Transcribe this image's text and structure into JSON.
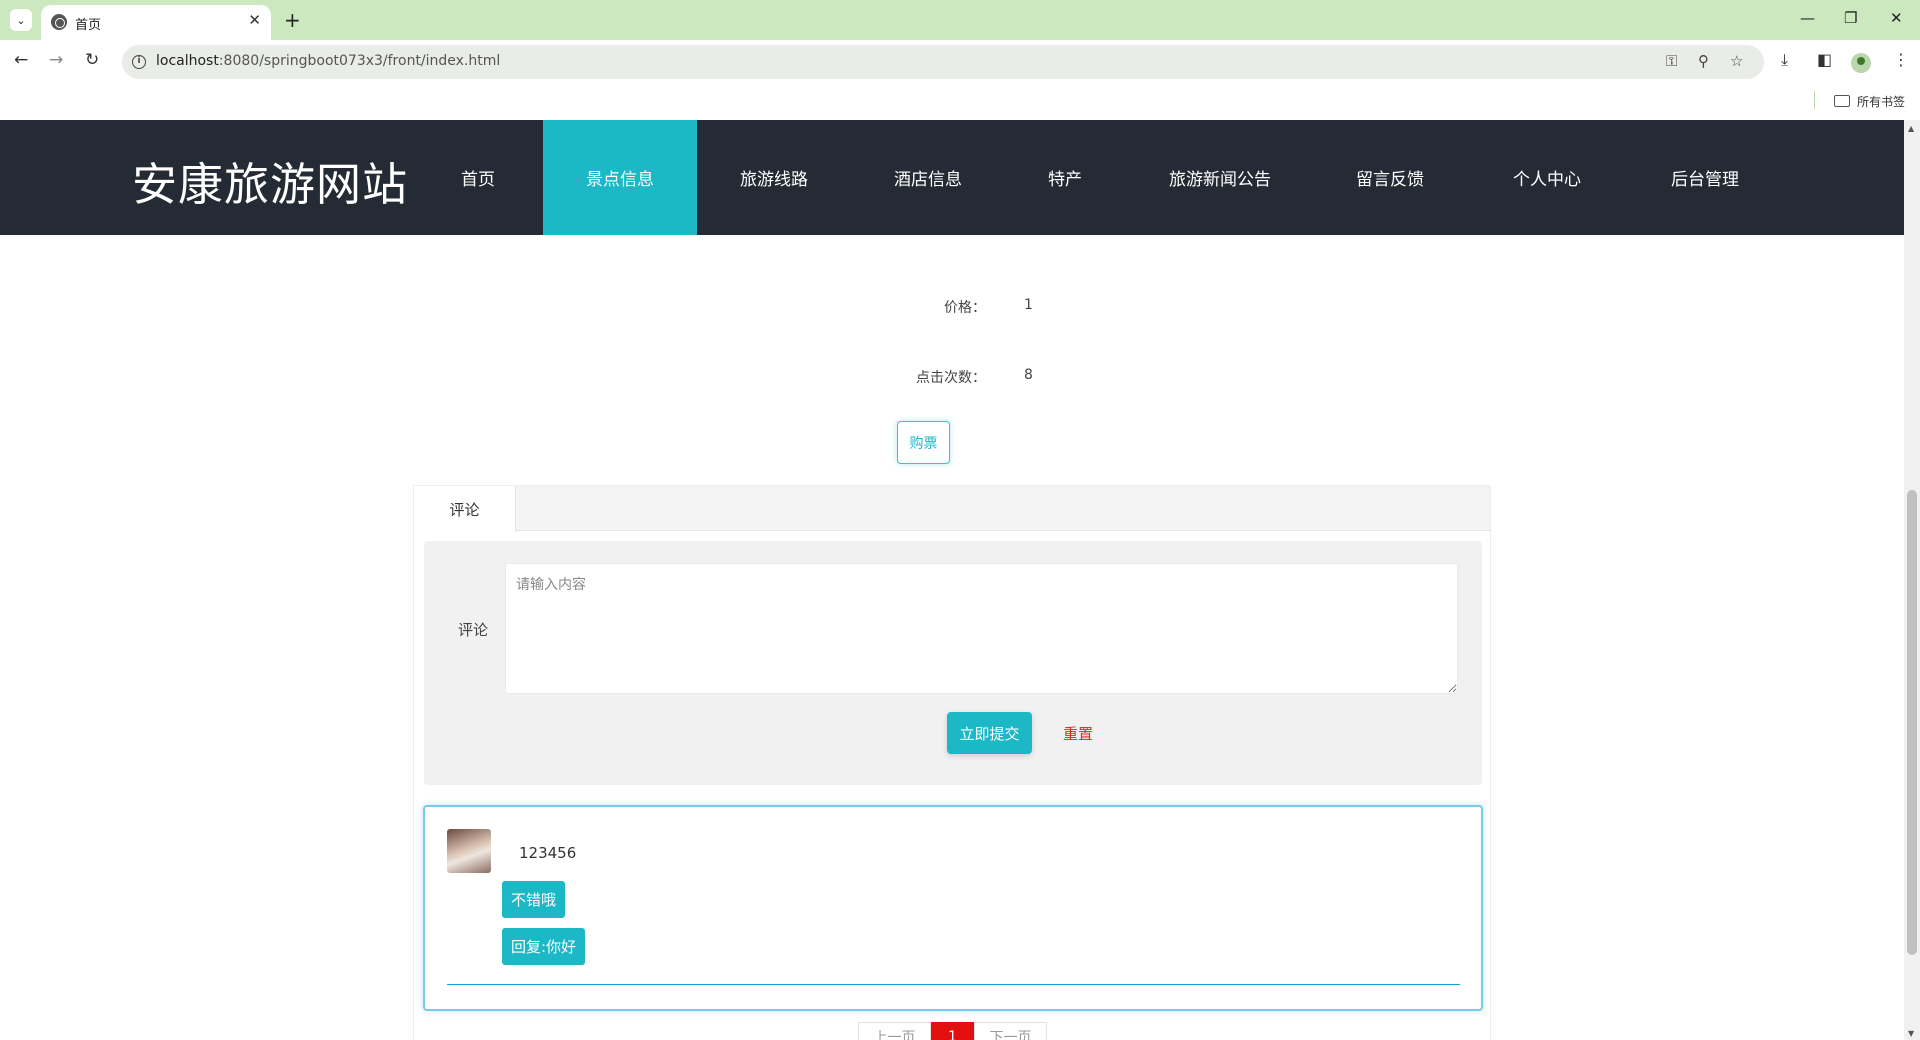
{
  "browser": {
    "tab_title": "首页",
    "url_host": "localhost",
    "url_rest": ":8080/springboot073x3/front/index.html",
    "bookmarks_label": "所有书签"
  },
  "site": {
    "title": "安康旅游网站",
    "nav": [
      {
        "label": "首页"
      },
      {
        "label": "景点信息",
        "active": true
      },
      {
        "label": "旅游线路"
      },
      {
        "label": "酒店信息"
      },
      {
        "label": "特产"
      },
      {
        "label": "旅游新闻公告"
      },
      {
        "label": "留言反馈"
      },
      {
        "label": "个人中心"
      },
      {
        "label": "后台管理"
      }
    ]
  },
  "details": {
    "price_label": "价格：",
    "price_value": "1",
    "clicks_label": "点击次数：",
    "clicks_value": "8",
    "buy_label": "购票"
  },
  "comments": {
    "tab_label": "评论",
    "form_label": "评论",
    "placeholder": "请输入内容",
    "submit_label": "立即提交",
    "reset_label": "重置",
    "items": [
      {
        "user": "123456",
        "content": "不错哦",
        "reply": "回复:你好"
      }
    ]
  },
  "pager": {
    "prev": "上一页",
    "current": "1",
    "next": "下一页"
  },
  "colors": {
    "header_bg": "#252b35",
    "accent": "#1cb8c6",
    "reset_text": "#e0261b",
    "pager_active": "#e30e0e"
  }
}
